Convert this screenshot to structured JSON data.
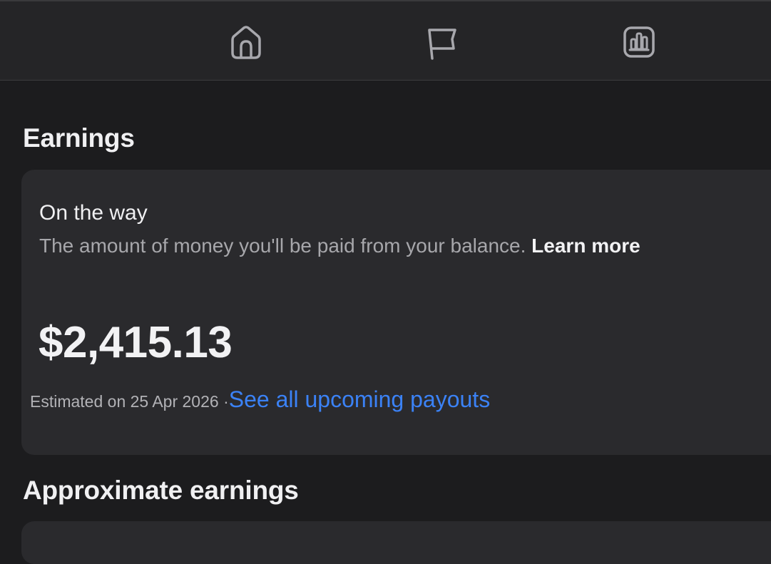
{
  "nav": {
    "items": [
      {
        "icon": "home-icon"
      },
      {
        "icon": "flag-icon"
      },
      {
        "icon": "bar-chart-icon"
      }
    ]
  },
  "earnings": {
    "title": "Earnings",
    "on_the_way": {
      "heading": "On the way",
      "description": "The amount of money you'll be paid from your balance.",
      "learn_more_label": "Learn more",
      "amount": "$2,415.13",
      "estimate_text": "Estimated on 25 Apr 2026 ·",
      "payouts_link_label": "See all upcoming payouts"
    }
  },
  "approximate": {
    "title": "Approximate earnings"
  },
  "colors": {
    "background": "#1c1c1e",
    "card": "#2a2a2d",
    "topbar": "#252527",
    "link": "#3b82f6"
  }
}
